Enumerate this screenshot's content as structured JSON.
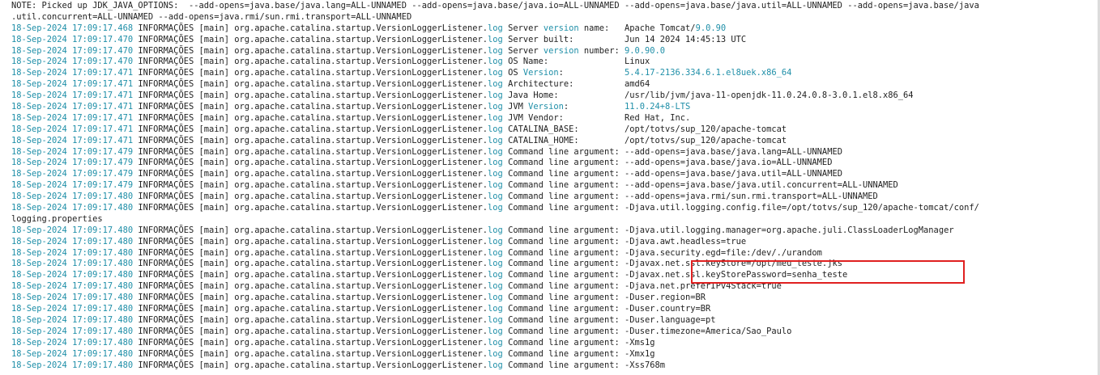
{
  "colors": {
    "timestamp": "#1f8fa8",
    "keyword": "#1f8fa8",
    "text": "#222222",
    "highlight_box": "#e02020"
  },
  "log_lines": [
    [
      {
        "t": "NOTE: Picked up JDK_JAVA_OPTIONS:  --add-opens=java.base/java.lang=ALL-UNNAMED --add-opens=java.base/java.io=ALL-UNNAMED --add-opens=java.base/java.util=ALL-UNNAMED --add-opens=java.base/java"
      }
    ],
    [
      {
        "t": ".util.concurrent=ALL-UNNAMED --add-opens=java.rmi/sun.rmi.transport=ALL-UNNAMED"
      }
    ],
    [
      {
        "t": "18-Sep-2024 17:09:17.468",
        "c": "ts"
      },
      {
        "t": " INFORMAÇÕES [main] org.apache.catalina.startup.VersionLoggerListener."
      },
      {
        "t": "log",
        "c": "hl"
      },
      {
        "t": " Server "
      },
      {
        "t": "version",
        "c": "hl"
      },
      {
        "t": " name:   Apache Tomcat/"
      },
      {
        "t": "9.0.90",
        "c": "hl"
      }
    ],
    [
      {
        "t": "18-Sep-2024 17:09:17.470",
        "c": "ts"
      },
      {
        "t": " INFORMAÇÕES [main] org.apache.catalina.startup.VersionLoggerListener."
      },
      {
        "t": "log",
        "c": "hl"
      },
      {
        "t": " Server built:          Jun 14 2024 14:45:13 UTC"
      }
    ],
    [
      {
        "t": "18-Sep-2024 17:09:17.470",
        "c": "ts"
      },
      {
        "t": " INFORMAÇÕES [main] org.apache.catalina.startup.VersionLoggerListener."
      },
      {
        "t": "log",
        "c": "hl"
      },
      {
        "t": " Server "
      },
      {
        "t": "version",
        "c": "hl"
      },
      {
        "t": " number: "
      },
      {
        "t": "9.0.90.0",
        "c": "hl"
      }
    ],
    [
      {
        "t": "18-Sep-2024 17:09:17.470",
        "c": "ts"
      },
      {
        "t": " INFORMAÇÕES [main] org.apache.catalina.startup.VersionLoggerListener."
      },
      {
        "t": "log",
        "c": "hl"
      },
      {
        "t": " OS Name:               Linux"
      }
    ],
    [
      {
        "t": "18-Sep-2024 17:09:17.471",
        "c": "ts"
      },
      {
        "t": " INFORMAÇÕES [main] org.apache.catalina.startup.VersionLoggerListener."
      },
      {
        "t": "log",
        "c": "hl"
      },
      {
        "t": " OS "
      },
      {
        "t": "Version",
        "c": "hl"
      },
      {
        "t": ":            "
      },
      {
        "t": "5.4.17-2136.334.6.1.el8uek.x86_64",
        "c": "hl"
      }
    ],
    [
      {
        "t": "18-Sep-2024 17:09:17.471",
        "c": "ts"
      },
      {
        "t": " INFORMAÇÕES [main] org.apache.catalina.startup.VersionLoggerListener."
      },
      {
        "t": "log",
        "c": "hl"
      },
      {
        "t": " Architecture:          amd64"
      }
    ],
    [
      {
        "t": "18-Sep-2024 17:09:17.471",
        "c": "ts"
      },
      {
        "t": " INFORMAÇÕES [main] org.apache.catalina.startup.VersionLoggerListener."
      },
      {
        "t": "log",
        "c": "hl"
      },
      {
        "t": " Java Home:             /usr/lib/jvm/java-11-openjdk-11.0.24.0.8-3.0.1.el8.x86_64"
      }
    ],
    [
      {
        "t": "18-Sep-2024 17:09:17.471",
        "c": "ts"
      },
      {
        "t": " INFORMAÇÕES [main] org.apache.catalina.startup.VersionLoggerListener."
      },
      {
        "t": "log",
        "c": "hl"
      },
      {
        "t": " JVM "
      },
      {
        "t": "Version",
        "c": "hl"
      },
      {
        "t": ":           "
      },
      {
        "t": "11.0.24+8-LTS",
        "c": "hl"
      }
    ],
    [
      {
        "t": "18-Sep-2024 17:09:17.471",
        "c": "ts"
      },
      {
        "t": " INFORMAÇÕES [main] org.apache.catalina.startup.VersionLoggerListener."
      },
      {
        "t": "log",
        "c": "hl"
      },
      {
        "t": " JVM Vendor:            Red Hat, Inc."
      }
    ],
    [
      {
        "t": "18-Sep-2024 17:09:17.471",
        "c": "ts"
      },
      {
        "t": " INFORMAÇÕES [main] org.apache.catalina.startup.VersionLoggerListener."
      },
      {
        "t": "log",
        "c": "hl"
      },
      {
        "t": " CATALINA_BASE:         /opt/totvs/sup_120/apache-tomcat"
      }
    ],
    [
      {
        "t": "18-Sep-2024 17:09:17.471",
        "c": "ts"
      },
      {
        "t": " INFORMAÇÕES [main] org.apache.catalina.startup.VersionLoggerListener."
      },
      {
        "t": "log",
        "c": "hl"
      },
      {
        "t": " CATALINA_HOME:         /opt/totvs/sup_120/apache-tomcat"
      }
    ],
    [
      {
        "t": "18-Sep-2024 17:09:17.479",
        "c": "ts"
      },
      {
        "t": " INFORMAÇÕES [main] org.apache.catalina.startup.VersionLoggerListener."
      },
      {
        "t": "log",
        "c": "hl"
      },
      {
        "t": " Command line argument: --add-opens=java.base/java.lang=ALL-UNNAMED"
      }
    ],
    [
      {
        "t": "18-Sep-2024 17:09:17.479",
        "c": "ts"
      },
      {
        "t": " INFORMAÇÕES [main] org.apache.catalina.startup.VersionLoggerListener."
      },
      {
        "t": "log",
        "c": "hl"
      },
      {
        "t": " Command line argument: --add-opens=java.base/java.io=ALL-UNNAMED"
      }
    ],
    [
      {
        "t": "18-Sep-2024 17:09:17.479",
        "c": "ts"
      },
      {
        "t": " INFORMAÇÕES [main] org.apache.catalina.startup.VersionLoggerListener."
      },
      {
        "t": "log",
        "c": "hl"
      },
      {
        "t": " Command line argument: --add-opens=java.base/java.util=ALL-UNNAMED"
      }
    ],
    [
      {
        "t": "18-Sep-2024 17:09:17.479",
        "c": "ts"
      },
      {
        "t": " INFORMAÇÕES [main] org.apache.catalina.startup.VersionLoggerListener."
      },
      {
        "t": "log",
        "c": "hl"
      },
      {
        "t": " Command line argument: --add-opens=java.base/java.util.concurrent=ALL-UNNAMED"
      }
    ],
    [
      {
        "t": "18-Sep-2024 17:09:17.480",
        "c": "ts"
      },
      {
        "t": " INFORMAÇÕES [main] org.apache.catalina.startup.VersionLoggerListener."
      },
      {
        "t": "log",
        "c": "hl"
      },
      {
        "t": " Command line argument: --add-opens=java.rmi/sun.rmi.transport=ALL-UNNAMED"
      }
    ],
    [
      {
        "t": "18-Sep-2024 17:09:17.480",
        "c": "ts"
      },
      {
        "t": " INFORMAÇÕES [main] org.apache.catalina.startup.VersionLoggerListener."
      },
      {
        "t": "log",
        "c": "hl"
      },
      {
        "t": " Command line argument: -Djava.util.logging.config.file=/opt/totvs/sup_120/apache-tomcat/conf/"
      }
    ],
    [
      {
        "t": "logging.properties"
      }
    ],
    [
      {
        "t": "18-Sep-2024 17:09:17.480",
        "c": "ts"
      },
      {
        "t": " INFORMAÇÕES [main] org.apache.catalina.startup.VersionLoggerListener."
      },
      {
        "t": "log",
        "c": "hl"
      },
      {
        "t": " Command line argument: -Djava.util.logging.manager=org.apache.juli.ClassLoaderLogManager"
      }
    ],
    [
      {
        "t": "18-Sep-2024 17:09:17.480",
        "c": "ts"
      },
      {
        "t": " INFORMAÇÕES [main] org.apache.catalina.startup.VersionLoggerListener."
      },
      {
        "t": "log",
        "c": "hl"
      },
      {
        "t": " Command line argument: -Djava.awt.headless=true"
      }
    ],
    [
      {
        "t": "18-Sep-2024 17:09:17.480",
        "c": "ts"
      },
      {
        "t": " INFORMAÇÕES [main] org.apache.catalina.startup.VersionLoggerListener."
      },
      {
        "t": "log",
        "c": "hl"
      },
      {
        "t": " Command line argument: -Djava.security.egd=file:/dev/./urandom"
      }
    ],
    [
      {
        "t": "18-Sep-2024 17:09:17.480",
        "c": "ts"
      },
      {
        "t": " INFORMAÇÕES [main] org.apache.catalina.startup.VersionLoggerListener."
      },
      {
        "t": "log",
        "c": "hl"
      },
      {
        "t": " Command line argument: -Djavax.net.ssl.keyStore=/opt/meu_teste.jks"
      }
    ],
    [
      {
        "t": "18-Sep-2024 17:09:17.480",
        "c": "ts"
      },
      {
        "t": " INFORMAÇÕES [main] org.apache.catalina.startup.VersionLoggerListener."
      },
      {
        "t": "log",
        "c": "hl"
      },
      {
        "t": " Command line argument: -Djavax.net.ssl.keyStorePassword=senha_teste"
      }
    ],
    [
      {
        "t": "18-Sep-2024 17:09:17.480",
        "c": "ts"
      },
      {
        "t": " INFORMAÇÕES [main] org.apache.catalina.startup.VersionLoggerListener."
      },
      {
        "t": "log",
        "c": "hl"
      },
      {
        "t": " Command line argument: -Djava.net.preferIPv4Stack=true"
      }
    ],
    [
      {
        "t": "18-Sep-2024 17:09:17.480",
        "c": "ts"
      },
      {
        "t": " INFORMAÇÕES [main] org.apache.catalina.startup.VersionLoggerListener."
      },
      {
        "t": "log",
        "c": "hl"
      },
      {
        "t": " Command line argument: -Duser.region=BR"
      }
    ],
    [
      {
        "t": "18-Sep-2024 17:09:17.480",
        "c": "ts"
      },
      {
        "t": " INFORMAÇÕES [main] org.apache.catalina.startup.VersionLoggerListener."
      },
      {
        "t": "log",
        "c": "hl"
      },
      {
        "t": " Command line argument: -Duser.country=BR"
      }
    ],
    [
      {
        "t": "18-Sep-2024 17:09:17.480",
        "c": "ts"
      },
      {
        "t": " INFORMAÇÕES [main] org.apache.catalina.startup.VersionLoggerListener."
      },
      {
        "t": "log",
        "c": "hl"
      },
      {
        "t": " Command line argument: -Duser.language=pt"
      }
    ],
    [
      {
        "t": "18-Sep-2024 17:09:17.480",
        "c": "ts"
      },
      {
        "t": " INFORMAÇÕES [main] org.apache.catalina.startup.VersionLoggerListener."
      },
      {
        "t": "log",
        "c": "hl"
      },
      {
        "t": " Command line argument: -Duser.timezone=America/Sao_Paulo"
      }
    ],
    [
      {
        "t": "18-Sep-2024 17:09:17.480",
        "c": "ts"
      },
      {
        "t": " INFORMAÇÕES [main] org.apache.catalina.startup.VersionLoggerListener."
      },
      {
        "t": "log",
        "c": "hl"
      },
      {
        "t": " Command line argument: -Xms1g"
      }
    ],
    [
      {
        "t": "18-Sep-2024 17:09:17.480",
        "c": "ts"
      },
      {
        "t": " INFORMAÇÕES [main] org.apache.catalina.startup.VersionLoggerListener."
      },
      {
        "t": "log",
        "c": "hl"
      },
      {
        "t": " Command line argument: -Xmx1g"
      }
    ],
    [
      {
        "t": "18-Sep-2024 17:09:17.480",
        "c": "ts"
      },
      {
        "t": " INFORMAÇÕES [main] org.apache.catalina.startup.VersionLoggerListener."
      },
      {
        "t": "log",
        "c": "hl"
      },
      {
        "t": " Command line argument: -Xss768m"
      }
    ]
  ]
}
